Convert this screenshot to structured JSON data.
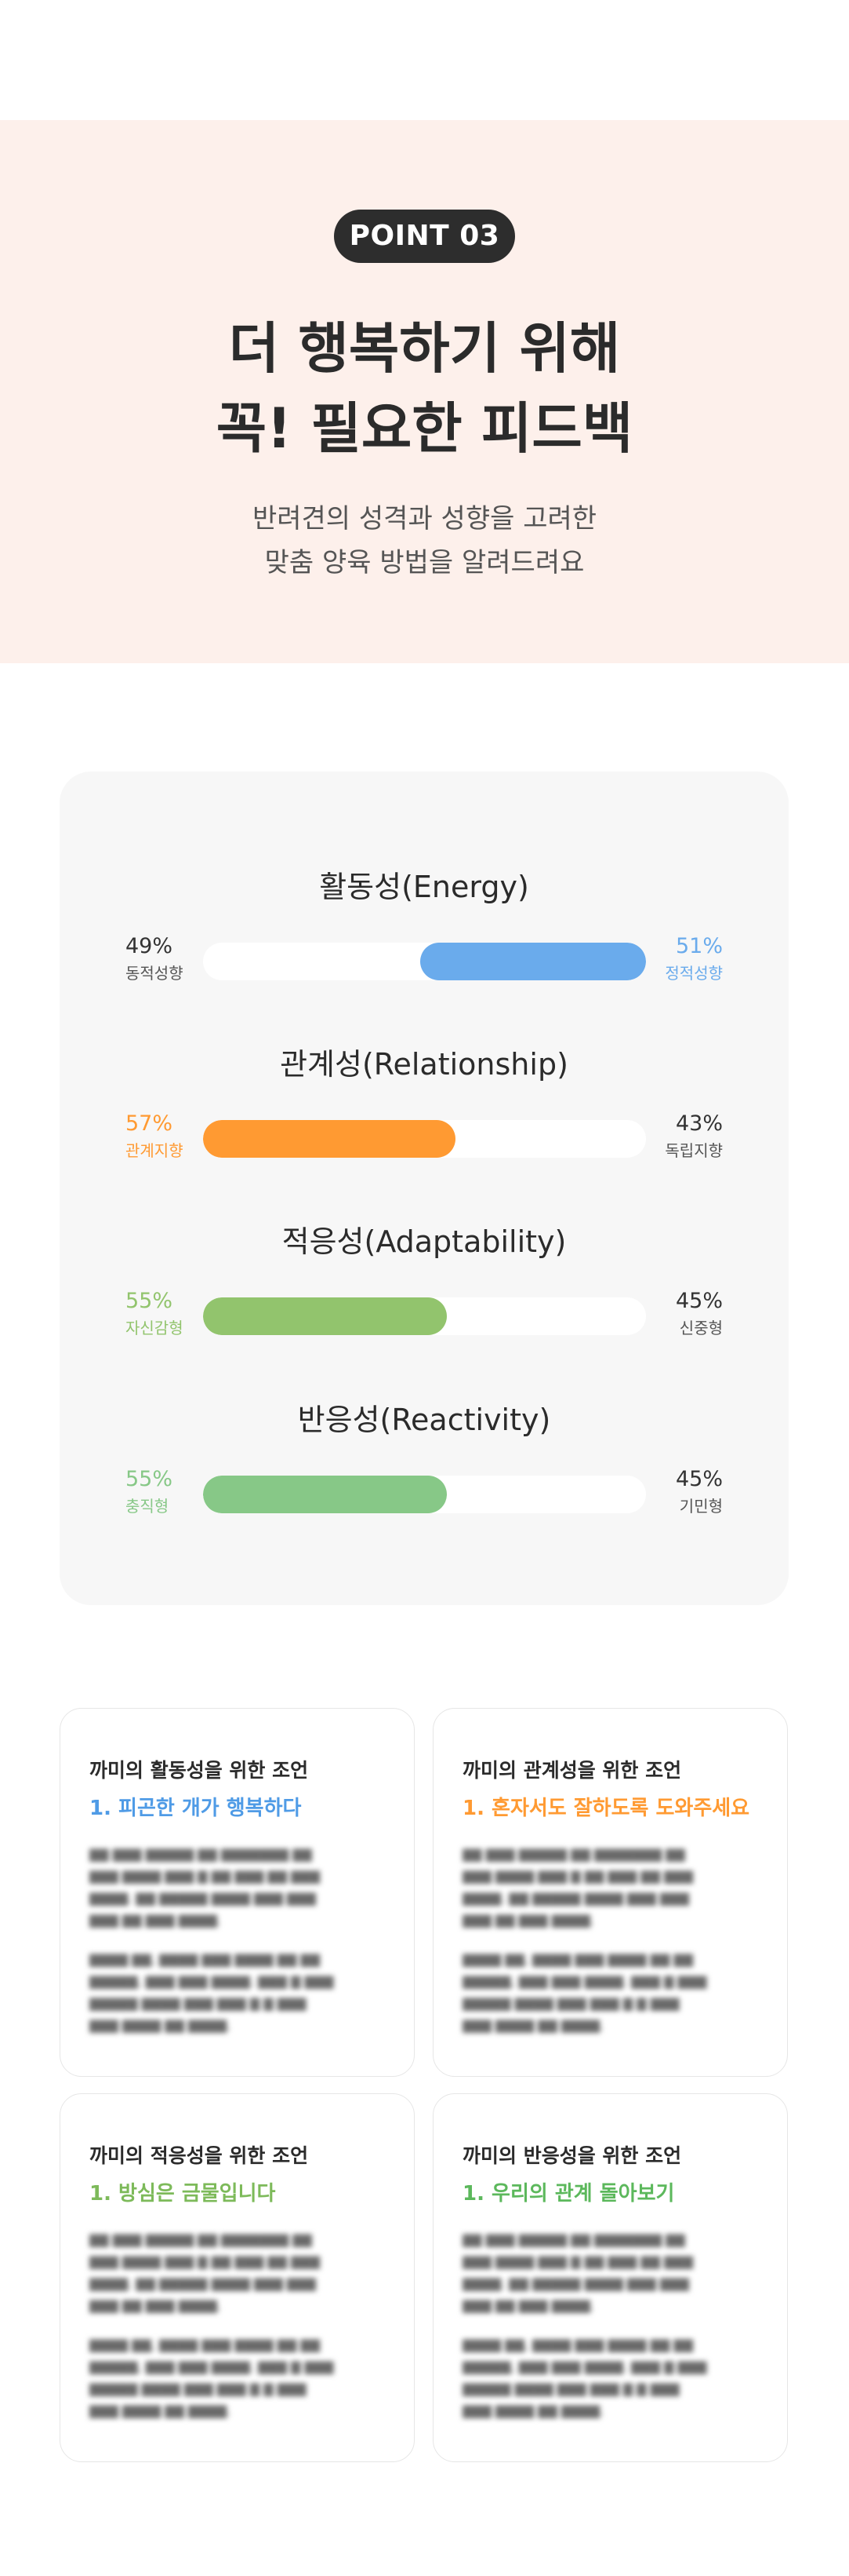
{
  "hero": {
    "badge": "POINT 03",
    "title_lines": [
      "더 행복하기 위해",
      "꼭! 필요한 피드백"
    ],
    "subtitle_lines": [
      "반려견의 성격과 성향을 고려한",
      "맞춤 양육 방법을 알려드려요"
    ]
  },
  "traits": [
    {
      "title": "활동성(Energy)",
      "left_pct": "49%",
      "left_label": "동적성향",
      "right_pct": "51%",
      "right_label": "정적성향",
      "fill_side": "right",
      "fill_fraction": 0.51,
      "color": "#6aabec",
      "highlight": "right"
    },
    {
      "title": "관계성(Relationship)",
      "left_pct": "57%",
      "left_label": "관계지향",
      "right_pct": "43%",
      "right_label": "독립지향",
      "fill_side": "left",
      "fill_fraction": 0.57,
      "color": "#ff9a32",
      "highlight": "left"
    },
    {
      "title": "적응성(Adaptability)",
      "left_pct": "55%",
      "left_label": "자신감형",
      "right_pct": "45%",
      "right_label": "신중형",
      "fill_side": "left",
      "fill_fraction": 0.55,
      "color": "#92c46d",
      "highlight": "left"
    },
    {
      "title": "반응성(Reactivity)",
      "left_pct": "55%",
      "left_label": "충직형",
      "right_pct": "45%",
      "right_label": "기민형",
      "fill_side": "left",
      "fill_fraction": 0.55,
      "color": "#87c887",
      "highlight": "left"
    }
  ],
  "advice_cards": [
    {
      "title": "까미의 활동성을 위한 조언",
      "subtitle": "1. 피곤한 개가 행복하다",
      "color": "#4f9be6"
    },
    {
      "title": "까미의 관계성을 위한 조언",
      "subtitle": "1. 혼자서도 잘하도록 도와주세요",
      "color": "#ff9a32"
    },
    {
      "title": "까미의 적응성을 위한 조언",
      "subtitle": "1. 방심은 금물입니다",
      "color": "#7dba5a"
    },
    {
      "title": "까미의 반응성을 위한 조언",
      "subtitle": "1. 우리의 관계 돌아보기",
      "color": "#5cb85c"
    }
  ],
  "colors": {
    "hero_bg": "#fdf0eb",
    "badge_bg": "#2d2d2d",
    "card_bg": "#f7f7f7",
    "neutral_text": "#555555"
  }
}
